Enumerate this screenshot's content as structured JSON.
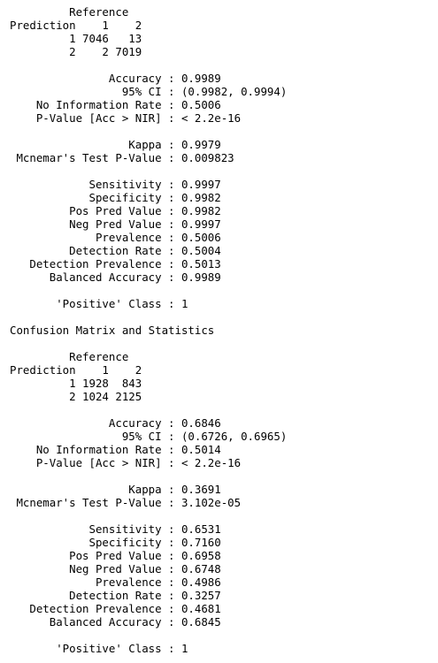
{
  "console": {
    "lines": [
      "         Reference",
      "Prediction    1    2",
      "         1 7046   13",
      "         2    2 7019",
      "",
      "               Accuracy : 0.9989",
      "                 95% CI : (0.9982, 0.9994)",
      "    No Information Rate : 0.5006",
      "    P-Value [Acc > NIR] : < 2.2e-16",
      "",
      "                  Kappa : 0.9979",
      " Mcnemar's Test P-Value : 0.009823",
      "",
      "            Sensitivity : 0.9997",
      "            Specificity : 0.9982",
      "         Pos Pred Value : 0.9982",
      "         Neg Pred Value : 0.9997",
      "             Prevalence : 0.5006",
      "         Detection Rate : 0.5004",
      "   Detection Prevalence : 0.5013",
      "      Balanced Accuracy : 0.9989",
      "",
      "       'Positive' Class : 1",
      "",
      "Confusion Matrix and Statistics",
      "",
      "         Reference",
      "Prediction    1    2",
      "         1 1928  843",
      "         2 1024 2125",
      "",
      "               Accuracy : 0.6846",
      "                 95% CI : (0.6726, 0.6965)",
      "    No Information Rate : 0.5014",
      "    P-Value [Acc > NIR] : < 2.2e-16",
      "",
      "                  Kappa : 0.3691",
      " Mcnemar's Test P-Value : 3.102e-05",
      "",
      "            Sensitivity : 0.6531",
      "            Specificity : 0.7160",
      "         Pos Pred Value : 0.6958",
      "         Neg Pred Value : 0.6748",
      "             Prevalence : 0.4986",
      "         Detection Rate : 0.3257",
      "   Detection Prevalence : 0.4681",
      "      Balanced Accuracy : 0.6845",
      "",
      "       'Positive' Class : 1"
    ]
  }
}
